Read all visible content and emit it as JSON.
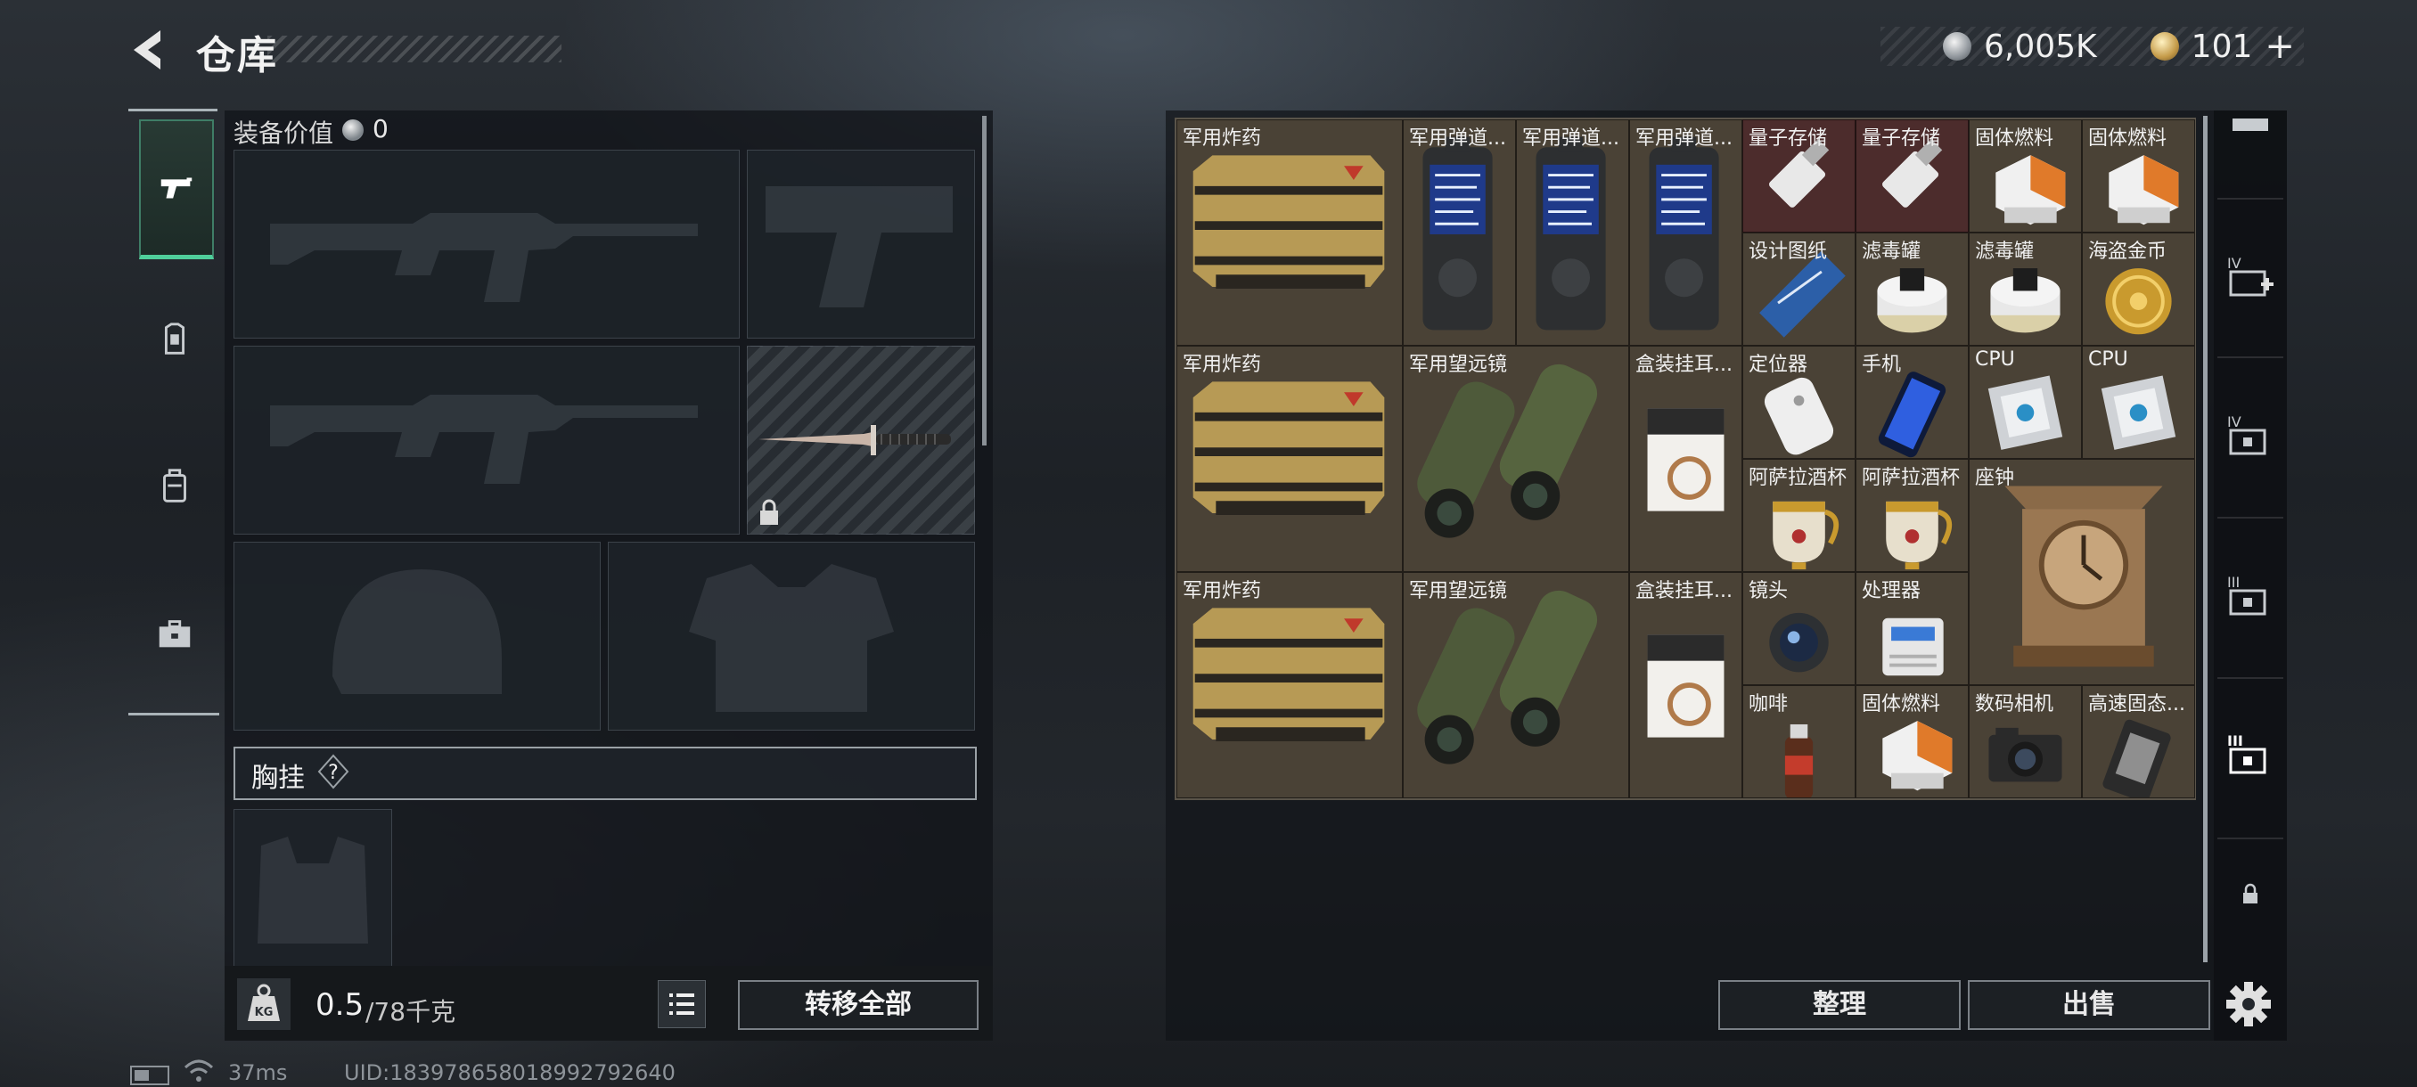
{
  "header": {
    "title": "仓库",
    "currency_silver": "6,005K",
    "currency_gold": "101",
    "gold_plus": "+"
  },
  "left_tabs": [
    {
      "icon": "pistol-icon",
      "active": true
    },
    {
      "icon": "armor-icon",
      "active": false
    },
    {
      "icon": "backpack-icon",
      "active": false
    },
    {
      "icon": "briefcase-icon",
      "active": false
    }
  ],
  "equipment": {
    "label": "装备价值",
    "value": "0",
    "slots": [
      "primary-weapon",
      "pistol",
      "secondary-weapon",
      "melee-knife",
      "helmet",
      "body-armor"
    ],
    "chest_rig_label": "胸挂",
    "chest_rig_help": "?"
  },
  "weight": {
    "current": "0.5",
    "max": "/78千克",
    "kg_icon_text": "KG"
  },
  "buttons": {
    "transfer_all": "转移全部",
    "sort": "整理",
    "sell": "出售"
  },
  "status_bar": {
    "ping": "37ms",
    "uid": "UID:1839786580189927926‌40"
  },
  "storage_items": [
    {
      "label": "军用炸药",
      "icon": "explosive-crate"
    },
    {
      "label": "军用弹道...",
      "icon": "ballistic-computer"
    },
    {
      "label": "军用弹道...",
      "icon": "ballistic-computer"
    },
    {
      "label": "军用弹道...",
      "icon": "ballistic-computer"
    },
    {
      "label": "量子存储",
      "icon": "usb-drive",
      "rarity": "red"
    },
    {
      "label": "量子存储",
      "icon": "usb-drive",
      "rarity": "red"
    },
    {
      "label": "固体燃料",
      "icon": "fuel-box"
    },
    {
      "label": "固体燃料",
      "icon": "fuel-box"
    },
    {
      "label": "设计图纸",
      "icon": "blueprint"
    },
    {
      "label": "滤毒罐",
      "icon": "filter-canister"
    },
    {
      "label": "滤毒罐",
      "icon": "filter-canister"
    },
    {
      "label": "海盗金币",
      "icon": "gold-coin"
    },
    {
      "label": "军用炸药",
      "icon": "explosive-crate"
    },
    {
      "label": "军用望远镜",
      "icon": "binoculars"
    },
    {
      "label": "盒装挂耳...",
      "icon": "coffee-box"
    },
    {
      "label": "定位器",
      "icon": "tracker"
    },
    {
      "label": "手机",
      "icon": "phone"
    },
    {
      "label": "CPU",
      "icon": "cpu"
    },
    {
      "label": "CPU",
      "icon": "cpu"
    },
    {
      "label": "阿萨拉酒杯",
      "icon": "goblet"
    },
    {
      "label": "阿萨拉酒杯",
      "icon": "goblet"
    },
    {
      "label": "座钟",
      "icon": "clock"
    },
    {
      "label": "军用炸药",
      "icon": "explosive-crate"
    },
    {
      "label": "军用望远镜",
      "icon": "binoculars"
    },
    {
      "label": "盒装挂耳...",
      "icon": "coffee-box"
    },
    {
      "label": "镜头",
      "icon": "lens"
    },
    {
      "label": "处理器",
      "icon": "processor"
    },
    {
      "label": "咖啡",
      "icon": "coffee-bottle"
    },
    {
      "label": "固体燃料",
      "icon": "fuel-box"
    },
    {
      "label": "数码相机",
      "icon": "camera"
    },
    {
      "label": "高速固态...",
      "icon": "ssd"
    }
  ],
  "right_tabs": [
    {
      "icon": "case-tab-icon"
    },
    {
      "icon": "case-iv-plus-icon",
      "text": "IV"
    },
    {
      "icon": "case-iv-icon",
      "text": "IV"
    },
    {
      "icon": "case-iii-icon",
      "text": "III"
    },
    {
      "icon": "case-iii-active-icon",
      "text": "III",
      "active": true
    },
    {
      "icon": "lock-icon"
    }
  ],
  "colors": {
    "accent_green": "#4fcf9b",
    "cell_brown": "#4a4236",
    "cell_red": "#4c2c2c"
  }
}
